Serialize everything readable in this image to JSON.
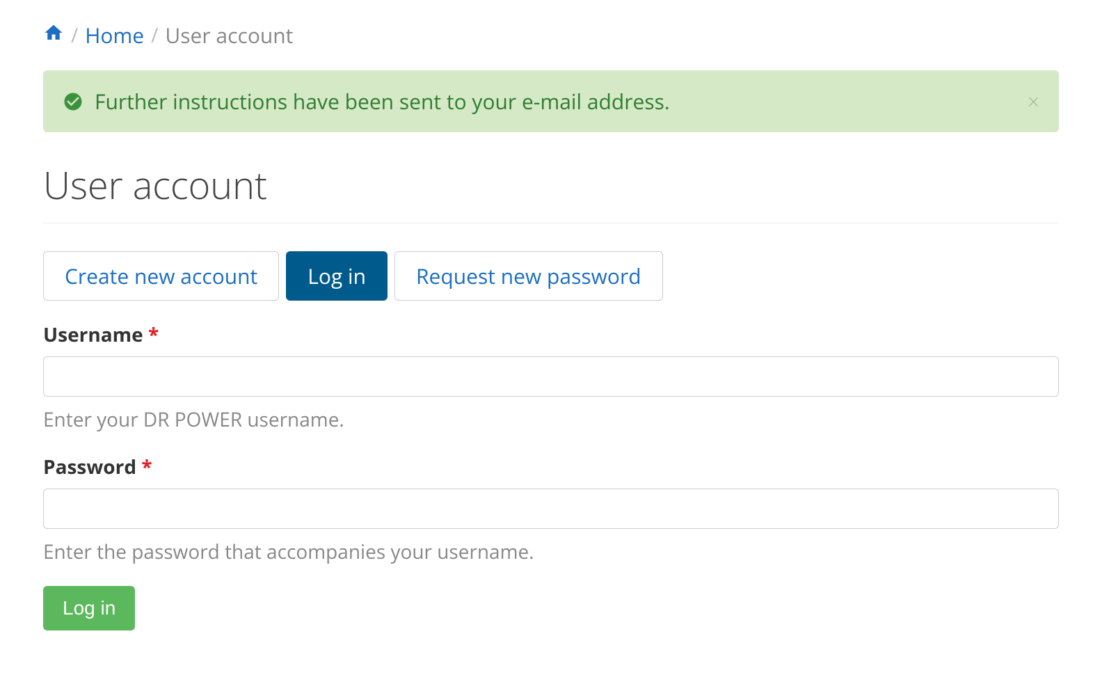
{
  "breadcrumb": {
    "home_link": "Home",
    "current": "User account"
  },
  "alert": {
    "message": "Further instructions have been sent to your e-mail address.",
    "close": "×"
  },
  "page_title": "User account",
  "tabs": {
    "create": "Create new account",
    "login": "Log in",
    "request": "Request new password"
  },
  "form": {
    "username_label": "Username",
    "username_required": "*",
    "username_help": "Enter your DR POWER username.",
    "password_label": "Password",
    "password_required": "*",
    "password_help": "Enter the password that accompanies your username.",
    "submit_label": "Log in"
  }
}
